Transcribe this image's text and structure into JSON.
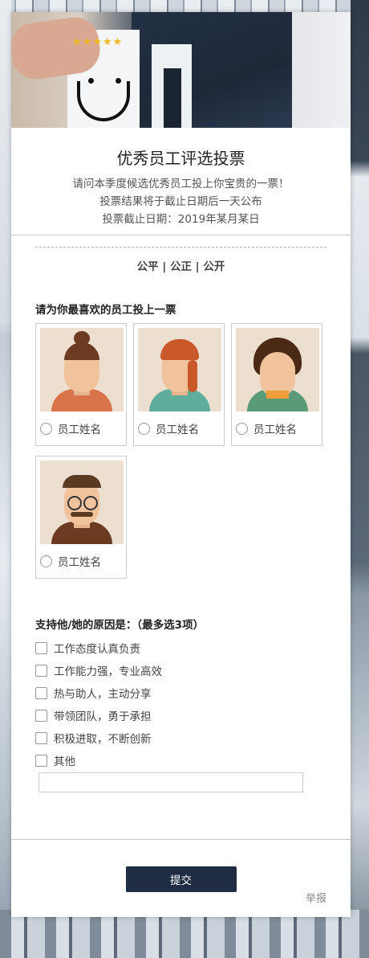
{
  "survey": {
    "title": "优秀员工评选投票",
    "desc_lines": [
      "请问本季度候选优秀员工投上你宝贵的一票！",
      "投票结果将于截止日期后一天公布",
      "投票截止日期：2019年某月某日"
    ],
    "motto": "公平 | 公正 | 公开"
  },
  "hero": {
    "stars": "★★★★★"
  },
  "question1": {
    "label": "请为你最喜欢的员工投上一票",
    "candidates": [
      {
        "name": "员工姓名",
        "avatar": "woman-bun-avatar"
      },
      {
        "name": "员工姓名",
        "avatar": "woman-redhair-avatar"
      },
      {
        "name": "员工姓名",
        "avatar": "woman-bob-avatar"
      },
      {
        "name": "员工姓名",
        "avatar": "man-mustache-avatar"
      }
    ]
  },
  "question2": {
    "label": "支持他/她的原因是：（最多选3项）",
    "options": [
      "工作态度认真负责",
      "工作能力强，专业高效",
      "热与助人，主动分享",
      "带领团队，勇于承担",
      "积极进取，不断创新",
      "其他"
    ],
    "other_placeholder": ""
  },
  "actions": {
    "submit_label": "提交",
    "report_label": "举报"
  },
  "colors": {
    "submit_bg": "#1f2c44",
    "star": "#f0b820"
  }
}
